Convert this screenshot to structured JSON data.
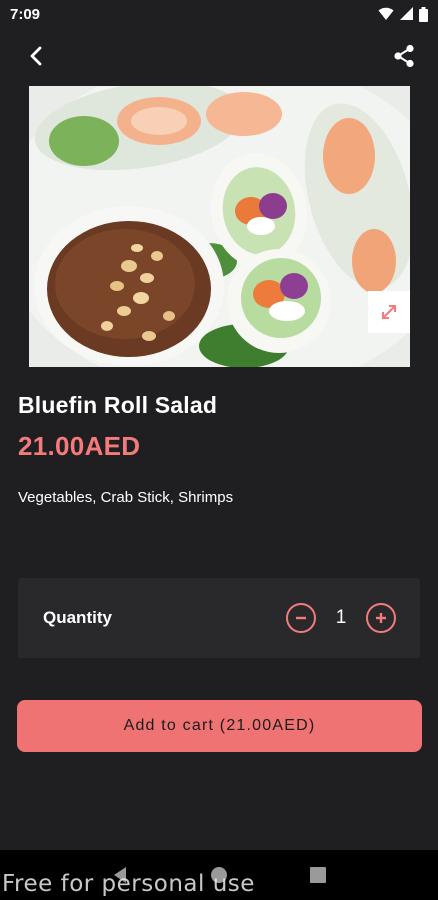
{
  "status_bar": {
    "time": "7:09",
    "icons": [
      "wifi-icon",
      "signal-icon",
      "battery-icon"
    ]
  },
  "app_bar": {
    "back_icon": "chevron-left-icon",
    "share_icon": "share-icon"
  },
  "product": {
    "image_icon": "expand-icon",
    "name": "Bluefin Roll Salad",
    "price": "21.00AED",
    "description": "Vegetables, Crab Stick, Shrimps"
  },
  "quantity": {
    "label": "Quantity",
    "value": "1",
    "decrement_icon": "minus-circle-icon",
    "increment_icon": "plus-circle-icon"
  },
  "cart": {
    "button_label": "Add to cart (21.00AED)"
  },
  "nav_bar": {
    "icons": [
      "back-triangle-icon",
      "home-circle-icon",
      "recents-square-icon"
    ]
  },
  "watermark": "Free for personal use",
  "colors": {
    "background": "#1f1f22",
    "card": "#29292c",
    "accent": "#f47b7b",
    "button": "#f07374"
  }
}
